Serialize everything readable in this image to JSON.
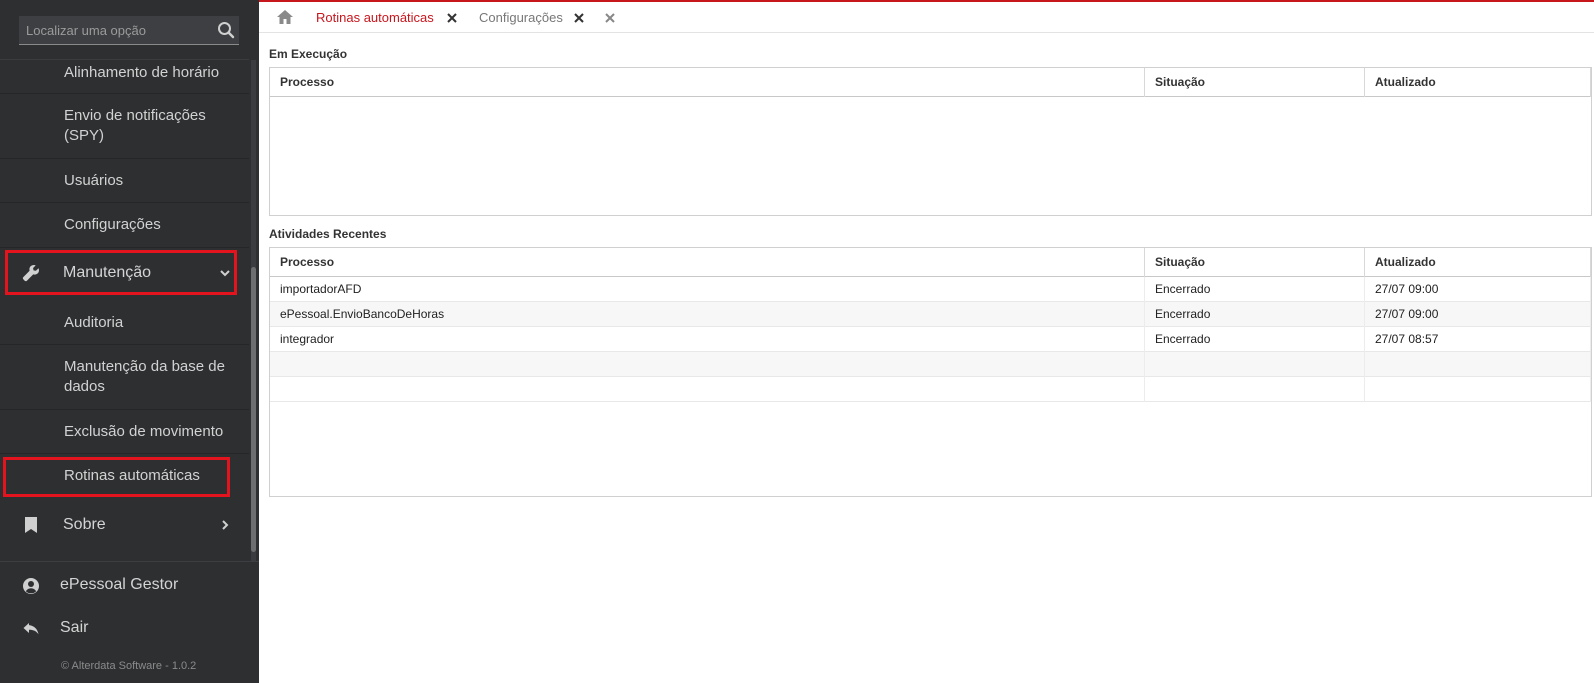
{
  "sidebar": {
    "search_placeholder": "Localizar uma opção",
    "items": [
      {
        "label": "Alinhamento de horário"
      },
      {
        "label": "Envio de notificações (SPY)"
      },
      {
        "label": "Usuários"
      },
      {
        "label": "Configurações"
      },
      {
        "label": "Manutenção"
      },
      {
        "label": "Auditoria"
      },
      {
        "label": "Manutenção da base de dados"
      },
      {
        "label": "Exclusão de movimento"
      },
      {
        "label": "Rotinas automáticas"
      },
      {
        "label": "Sobre"
      }
    ],
    "user": {
      "label": "ePessoal Gestor",
      "logout": "Sair"
    },
    "copyright": "© Alterdata Software - 1.0.2"
  },
  "tabs": [
    {
      "label": "Rotinas automáticas",
      "active": true
    },
    {
      "label": "Configurações",
      "active": false
    }
  ],
  "running": {
    "title": "Em Execução",
    "columns": [
      "Processo",
      "Situação",
      "Atualizado"
    ],
    "rows": []
  },
  "recent": {
    "title": "Atividades Recentes",
    "columns": [
      "Processo",
      "Situação",
      "Atualizado"
    ],
    "rows": [
      [
        "importadorAFD",
        "Encerrado",
        "27/07 09:00"
      ],
      [
        "ePessoal.EnvioBancoDeHoras",
        "Encerrado",
        "27/07 09:00"
      ],
      [
        "integrador",
        "Encerrado",
        "27/07 08:57"
      ]
    ]
  },
  "colors": {
    "accent": "#c8161d",
    "highlight": "#e3141d",
    "sidebar_bg": "#2d2f31"
  }
}
